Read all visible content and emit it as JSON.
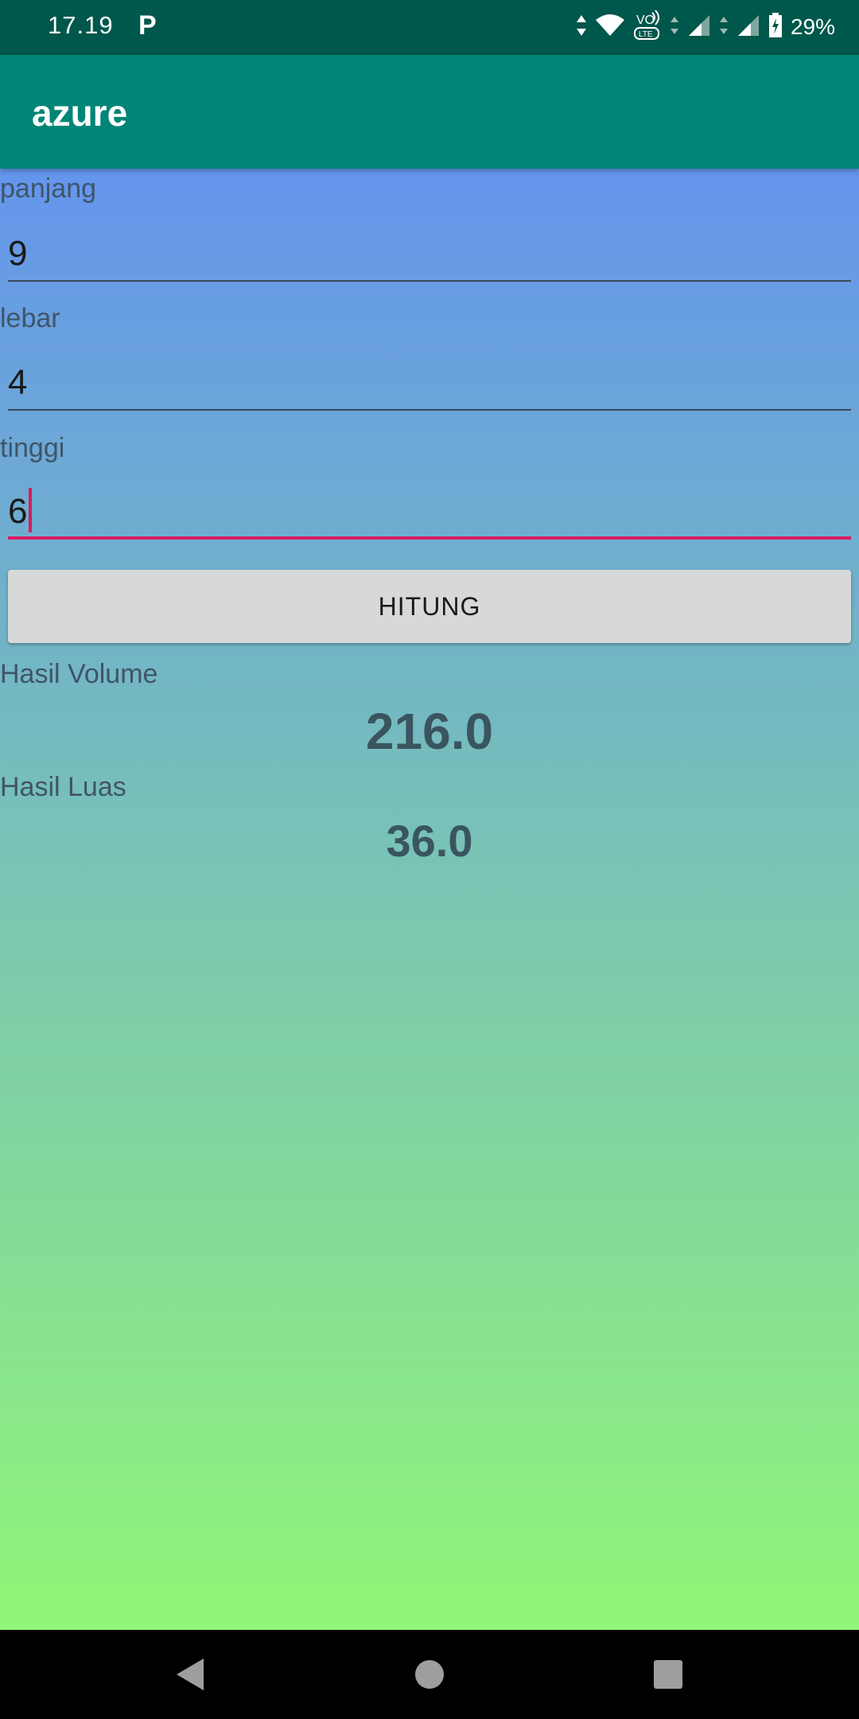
{
  "status_bar": {
    "time": "17.19",
    "notification_icon": "P",
    "battery_percent": "29%",
    "icons": [
      "data-arrows-icon",
      "wifi-icon",
      "volte-icon",
      "signal-icon",
      "signal-icon",
      "battery-charging-icon"
    ]
  },
  "app_bar": {
    "title": "azure"
  },
  "form": {
    "panjang": {
      "label": "panjang",
      "value": "9"
    },
    "lebar": {
      "label": "lebar",
      "value": "4"
    },
    "tinggi": {
      "label": "tinggi",
      "value": "6"
    },
    "button_label": "HITUNG"
  },
  "results": {
    "volume_label": "Hasil Volume",
    "volume_value": "216.0",
    "luas_label": "Hasil Luas",
    "luas_value": "36.0"
  },
  "nav_bar": {
    "buttons": [
      "back-icon",
      "home-icon",
      "recents-icon"
    ]
  },
  "colors": {
    "status_bar": "#00574B",
    "app_bar": "#008577",
    "gradient_top": "#6495ED",
    "gradient_bottom": "#90F677",
    "accent": "#D81B60",
    "button_bg": "#D7D8D8"
  }
}
